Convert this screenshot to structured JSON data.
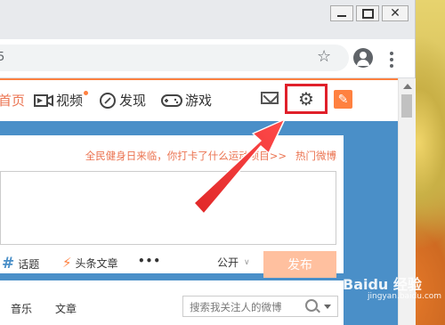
{
  "nav": {
    "home_label": "首页",
    "video_label": "视频",
    "discover_label": "发现",
    "game_label": "游戏"
  },
  "address_bar": {
    "url_fragment": "5"
  },
  "composer": {
    "promo_text": "全民健身日来临，你打卡了什么运动项目>>",
    "hot_link": "热门微博",
    "topic_label": "话题",
    "article_label": "头条文章",
    "more_label": "•••",
    "visibility_label": "公开",
    "send_label": "发布"
  },
  "tabs": {
    "music": "音乐",
    "article": "文章"
  },
  "search": {
    "placeholder": "搜索我关注人的微博"
  },
  "watermark": {
    "brand": "Baidu 经验",
    "url": "jingyan.baidu.com"
  },
  "colors": {
    "accent_orange": "#ff8140",
    "highlight_red": "#e0202a",
    "content_blue": "#4a8fc8",
    "promo_text": "#eb7350"
  },
  "icons": [
    "video-icon",
    "discover-icon",
    "game-icon",
    "mail-icon",
    "gear-icon",
    "compose-icon",
    "hash-icon",
    "lightning-icon",
    "search-icon",
    "star-icon",
    "account-icon",
    "menu-icon"
  ]
}
